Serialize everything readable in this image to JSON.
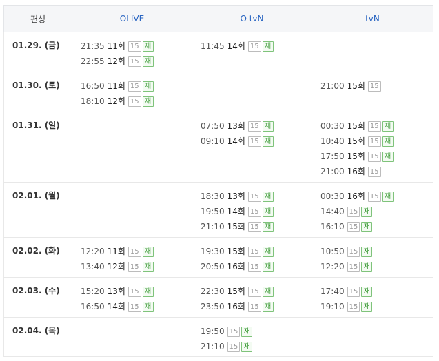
{
  "header": {
    "day_label": "편성",
    "channels": [
      "OLIVE",
      "O tvN",
      "tvN"
    ]
  },
  "rows": [
    {
      "date": "01.29. (금)",
      "cells": [
        [
          {
            "time": "21:35",
            "ep": "11회",
            "rating": "15",
            "rerun": "재"
          },
          {
            "time": "22:55",
            "ep": "12회",
            "rating": "15",
            "rerun": "재"
          }
        ],
        [
          {
            "time": "11:45",
            "ep": "14회",
            "rating": "15",
            "rerun": "재"
          }
        ],
        []
      ]
    },
    {
      "date": "01.30. (토)",
      "cells": [
        [
          {
            "time": "16:50",
            "ep": "11회",
            "rating": "15",
            "rerun": "재"
          },
          {
            "time": "18:10",
            "ep": "12회",
            "rating": "15",
            "rerun": "재"
          }
        ],
        [],
        [
          {
            "time": "21:00",
            "ep": "15회",
            "rating": "15",
            "rerun": ""
          }
        ]
      ]
    },
    {
      "date": "01.31. (일)",
      "cells": [
        [],
        [
          {
            "time": "07:50",
            "ep": "13회",
            "rating": "15",
            "rerun": "재"
          },
          {
            "time": "09:10",
            "ep": "14회",
            "rating": "15",
            "rerun": "재"
          }
        ],
        [
          {
            "time": "00:30",
            "ep": "15회",
            "rating": "15",
            "rerun": "재"
          },
          {
            "time": "10:40",
            "ep": "15회",
            "rating": "15",
            "rerun": "재"
          },
          {
            "time": "17:50",
            "ep": "15회",
            "rating": "15",
            "rerun": "재"
          },
          {
            "time": "21:00",
            "ep": "16회",
            "rating": "15",
            "rerun": ""
          }
        ]
      ]
    },
    {
      "date": "02.01. (월)",
      "cells": [
        [],
        [
          {
            "time": "18:30",
            "ep": "13회",
            "rating": "15",
            "rerun": "재"
          },
          {
            "time": "19:50",
            "ep": "14회",
            "rating": "15",
            "rerun": "재"
          },
          {
            "time": "21:10",
            "ep": "15회",
            "rating": "15",
            "rerun": "재"
          }
        ],
        [
          {
            "time": "00:30",
            "ep": "16회",
            "rating": "15",
            "rerun": "재"
          },
          {
            "time": "14:40",
            "ep": "",
            "rating": "15",
            "rerun": "재"
          },
          {
            "time": "16:10",
            "ep": "",
            "rating": "15",
            "rerun": "재"
          }
        ]
      ]
    },
    {
      "date": "02.02. (화)",
      "cells": [
        [
          {
            "time": "12:20",
            "ep": "11회",
            "rating": "15",
            "rerun": "재"
          },
          {
            "time": "13:40",
            "ep": "12회",
            "rating": "15",
            "rerun": "재"
          }
        ],
        [
          {
            "time": "19:30",
            "ep": "15회",
            "rating": "15",
            "rerun": "재"
          },
          {
            "time": "20:50",
            "ep": "16회",
            "rating": "15",
            "rerun": "재"
          }
        ],
        [
          {
            "time": "10:50",
            "ep": "",
            "rating": "15",
            "rerun": "재"
          },
          {
            "time": "12:20",
            "ep": "",
            "rating": "15",
            "rerun": "재"
          }
        ]
      ]
    },
    {
      "date": "02.03. (수)",
      "cells": [
        [
          {
            "time": "15:20",
            "ep": "13회",
            "rating": "15",
            "rerun": "재"
          },
          {
            "time": "16:50",
            "ep": "14회",
            "rating": "15",
            "rerun": "재"
          }
        ],
        [
          {
            "time": "22:30",
            "ep": "15회",
            "rating": "15",
            "rerun": "재"
          },
          {
            "time": "23:50",
            "ep": "16회",
            "rating": "15",
            "rerun": "재"
          }
        ],
        [
          {
            "time": "17:40",
            "ep": "",
            "rating": "15",
            "rerun": "재"
          },
          {
            "time": "19:10",
            "ep": "",
            "rating": "15",
            "rerun": "재"
          }
        ]
      ]
    },
    {
      "date": "02.04. (목)",
      "cells": [
        [],
        [
          {
            "time": "19:50",
            "ep": "",
            "rating": "15",
            "rerun": "재"
          },
          {
            "time": "21:10",
            "ep": "",
            "rating": "15",
            "rerun": "재"
          }
        ],
        []
      ]
    }
  ]
}
